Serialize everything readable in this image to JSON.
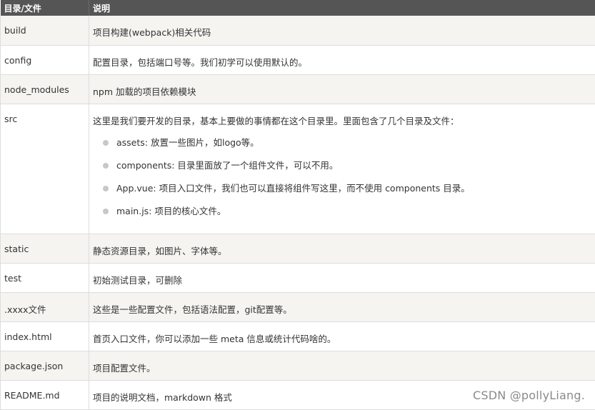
{
  "table": {
    "headers": [
      "目录/文件",
      "说明"
    ],
    "rows": [
      {
        "name": "build",
        "desc": "项目构建(webpack)相关代码"
      },
      {
        "name": "config",
        "desc": "配置目录，包括端口号等。我们初学可以使用默认的。"
      },
      {
        "name": "node_modules",
        "desc": "npm 加载的项目依赖模块"
      },
      {
        "name": "src",
        "desc": "这里是我们要开发的目录，基本上要做的事情都在这个目录里。里面包含了几个目录及文件：",
        "items": [
          "assets: 放置一些图片，如logo等。",
          "components: 目录里面放了一个组件文件，可以不用。",
          "App.vue: 项目入口文件，我们也可以直接将组件写这里，而不使用 components 目录。",
          "main.js: 项目的核心文件。"
        ]
      },
      {
        "name": "static",
        "desc": "静态资源目录，如图片、字体等。"
      },
      {
        "name": "test",
        "desc": "初始测试目录，可删除"
      },
      {
        "name": ".xxxx文件",
        "desc": "这些是一些配置文件，包括语法配置，git配置等。"
      },
      {
        "name": "index.html",
        "desc": "首页入口文件，你可以添加一些 meta 信息或统计代码啥的。"
      },
      {
        "name": "package.json",
        "desc": "项目配置文件。"
      },
      {
        "name": "README.md",
        "desc": "项目的说明文档，markdown 格式"
      }
    ]
  },
  "watermark": "CSDN @pollyLiang.",
  "colors": {
    "header_bg": "#555555",
    "alt_row_bg": "#f6f4f0",
    "border": "#dddddd",
    "bullet": "#c8c8c8"
  }
}
